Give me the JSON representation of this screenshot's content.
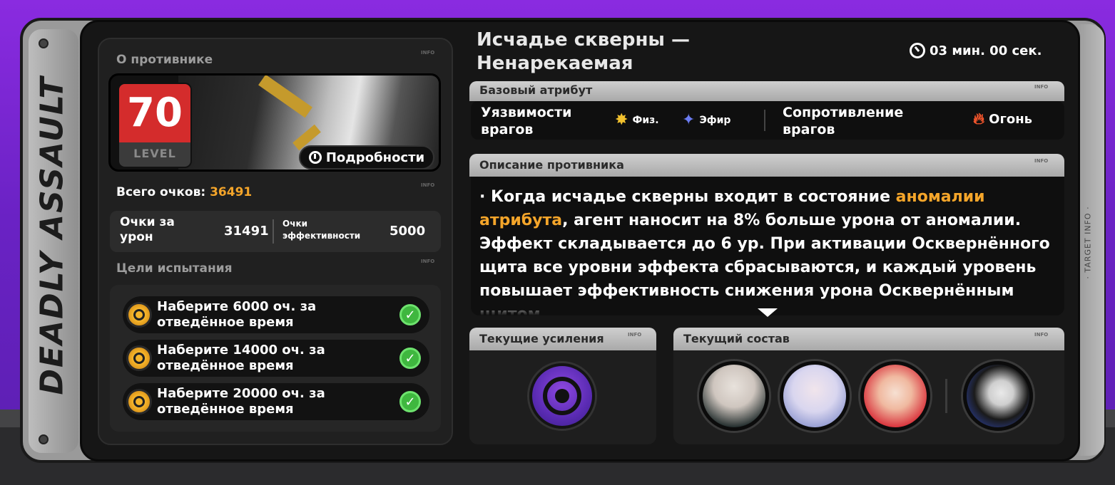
{
  "sidebar": {
    "logo_text": "DEADLY ASSAULT",
    "target_info": "· TARGET INFO ·"
  },
  "enemy": {
    "section_title": "О противнике",
    "info_tag": "INFO",
    "level": "70",
    "level_label": "LEVEL",
    "details_button": "Подробности"
  },
  "scores": {
    "total_label": "Всего очков:",
    "total_value": "36491",
    "damage_label": "Очки за урон",
    "damage_value": "31491",
    "efficiency_label": "Очки эффективности",
    "efficiency_value": "5000"
  },
  "goals": {
    "section_title": "Цели испытания",
    "items": [
      {
        "text": "Наберите 6000 оч. за отведённое время",
        "done": true
      },
      {
        "text": "Наберите 14000 оч. за отведённое время",
        "done": true
      },
      {
        "text": "Наберите 20000 оч. за отведённое время",
        "done": true
      }
    ]
  },
  "header": {
    "title": "Исчадье скверны — Ненарекаемая",
    "timer": "03 мин. 00 сек."
  },
  "attributes": {
    "section_title": "Базовый атрибут",
    "weakness_label": "Уязвимости врагов",
    "weakness_1": "Физ.",
    "weakness_2": "Эфир",
    "resistance_label": "Сопротивление врагов",
    "resistance_1": "Огонь"
  },
  "description": {
    "section_title": "Описание противника",
    "part1": "· Когда исчадье скверны входит в состояние ",
    "highlight": "аномалии атрибута",
    "part2": ", агент наносит на 8% больше урона от аномалии. Эффект складывается до 6 ур. При активации Осквернённого щита все уровни эффекта сбрасываются, и каждый уровень повышает эффективность снижения урона Осквернённым щитом"
  },
  "buffs": {
    "section_title": "Текущие усиления"
  },
  "squad": {
    "section_title": "Текущий состав"
  },
  "colors": {
    "accent": "#f4a52a",
    "level_red": "#d42c2c",
    "check_green": "#3fb73f",
    "background_purple": "#7a28d0"
  }
}
